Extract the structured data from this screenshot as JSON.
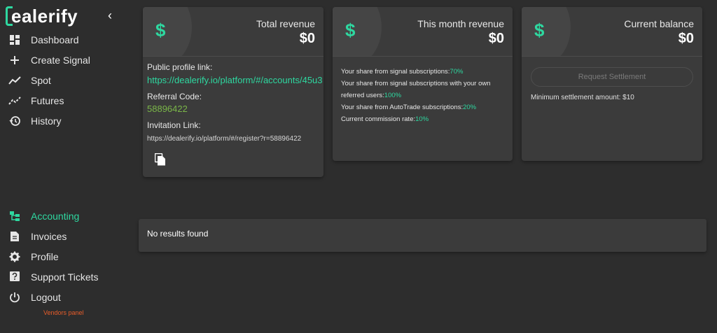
{
  "brand": {
    "name": "ealerify",
    "accent": "#2ed8a0"
  },
  "sidebar": {
    "collapse_icon": "chevron-left-icon",
    "items_top": [
      {
        "label": "Dashboard",
        "icon": "dashboard-icon"
      },
      {
        "label": "Create Signal",
        "icon": "plus-icon"
      },
      {
        "label": "Spot",
        "icon": "trend-line-icon"
      },
      {
        "label": "Futures",
        "icon": "trend-dashed-icon"
      },
      {
        "label": "History",
        "icon": "history-icon"
      }
    ],
    "items_bottom": [
      {
        "label": "Accounting",
        "icon": "accounting-icon",
        "active": true
      },
      {
        "label": "Invoices",
        "icon": "document-icon"
      },
      {
        "label": "Profile",
        "icon": "gear-icon"
      },
      {
        "label": "Support Tickets",
        "icon": "question-icon"
      },
      {
        "label": "Logout",
        "icon": "power-icon"
      }
    ],
    "vendors_label": "Vendors panel"
  },
  "cards": {
    "total_revenue": {
      "title": "Total revenue",
      "amount": "$0",
      "icon": "dollar-icon",
      "public_profile_label": "Public profile link:",
      "public_profile_link": "https://dealerify.io/platform/#/accounts/45u3",
      "referral_label": "Referral Code:",
      "referral_code": "58896422",
      "invitation_label": "Invitation Link:",
      "invitation_link": "https://dealerify.io/platform/#/register?r=58896422",
      "copy_icon": "copy-icon"
    },
    "month_revenue": {
      "title": "This month revenue",
      "amount": "$0",
      "icon": "dollar-icon",
      "shares": [
        {
          "text": "Your share from signal subscriptions:",
          "value": "70%"
        },
        {
          "text": "Your share from signal subscriptions with your own referred users:",
          "value": "100%"
        },
        {
          "text": "Your share from AutoTrade subscriptions:",
          "value": "20%"
        },
        {
          "text": "Current commission rate:",
          "value": "10%"
        }
      ]
    },
    "current_balance": {
      "title": "Current balance",
      "amount": "$0",
      "icon": "dollar-icon",
      "settlement_button": "Request Settlement",
      "minimum_text": "Minimum settlement amount: $10"
    }
  },
  "results": {
    "message": "No results found"
  }
}
